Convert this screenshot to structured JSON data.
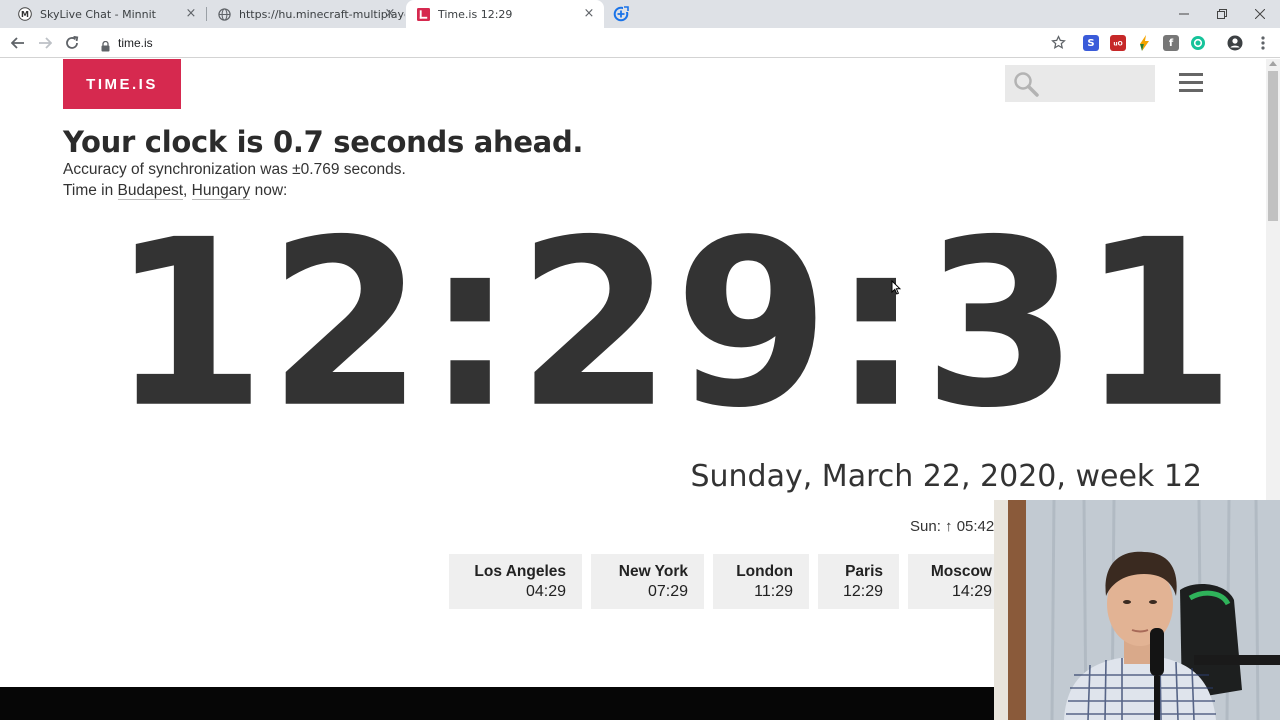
{
  "browser": {
    "tabs": [
      {
        "title": "SkyLive Chat - Minnit",
        "favicon": "M"
      },
      {
        "title": "https://hu.minecraft-multiplayer.",
        "favicon": "globe"
      },
      {
        "title": "Time.is 12:29",
        "favicon": "time-is"
      }
    ],
    "url": "time.is"
  },
  "site": {
    "logo": "TIME.IS",
    "headline": "Your clock is 0.7 seconds ahead.",
    "accuracy": "Accuracy of synchronization was ±0.769 seconds.",
    "location_prefix": "Time in ",
    "city": "Budapest",
    "sep": ", ",
    "country": "Hungary",
    "location_suffix": " now:",
    "clock": "12:29:31",
    "date": "Sunday, March 22, 2020, week 12",
    "sun": "Sun: ↑ 05:42",
    "cities": [
      {
        "name": "Los Angeles",
        "time": "04:29"
      },
      {
        "name": "New York",
        "time": "07:29"
      },
      {
        "name": "London",
        "time": "11:29"
      },
      {
        "name": "Paris",
        "time": "12:29"
      },
      {
        "name": "Moscow",
        "time": "14:29"
      }
    ]
  },
  "colors": {
    "brand": "#d6294f",
    "text": "#333333",
    "city_tile": "#efefef"
  }
}
